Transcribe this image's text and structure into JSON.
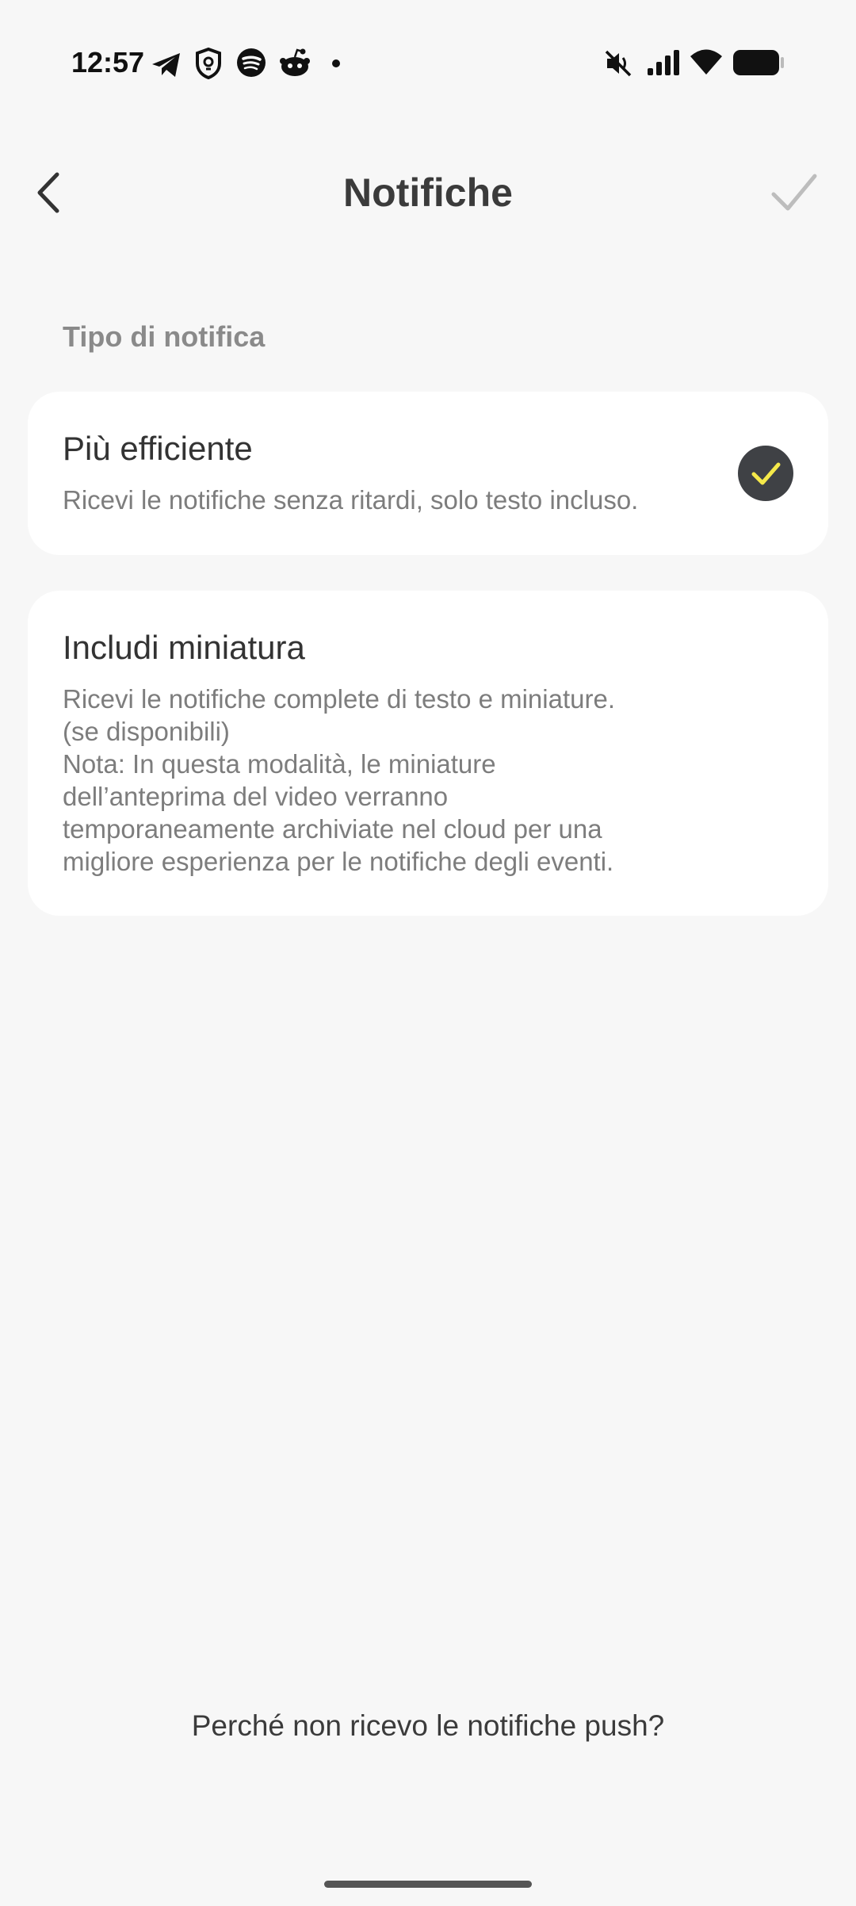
{
  "status_bar": {
    "time": "12:57",
    "left_icons": [
      "telegram-icon",
      "shield-icon",
      "spotify-icon",
      "reddit-icon",
      "dot-icon"
    ],
    "right_icons": [
      "mute-icon",
      "signal-icon",
      "wifi-icon",
      "battery-icon"
    ]
  },
  "header": {
    "title": "Notifiche",
    "back_icon": "chevron-left-icon",
    "confirm_icon": "check-icon"
  },
  "section": {
    "label": "Tipo di notifica"
  },
  "options": [
    {
      "title": "Più efficiente",
      "description": "Ricevi le notifiche senza ritardi, solo testo incluso.",
      "selected": true
    },
    {
      "title": "Includi miniatura",
      "description": "Ricevi le notifiche complete di testo e miniature.\n(se disponibili)\nNota: In questa modalità, le miniature\ndell’anteprima del video verranno\ntemporaneamente archiviate nel cloud per una\nmigliore esperienza per le notifiche degli eventi.",
      "selected": false
    }
  ],
  "footer": {
    "help_link": "Perché non ricevo le notifiche push?"
  },
  "colors": {
    "background": "#f7f7f7",
    "card": "#ffffff",
    "check_circle": "#3f4145",
    "check_mark": "#f5e94a"
  }
}
